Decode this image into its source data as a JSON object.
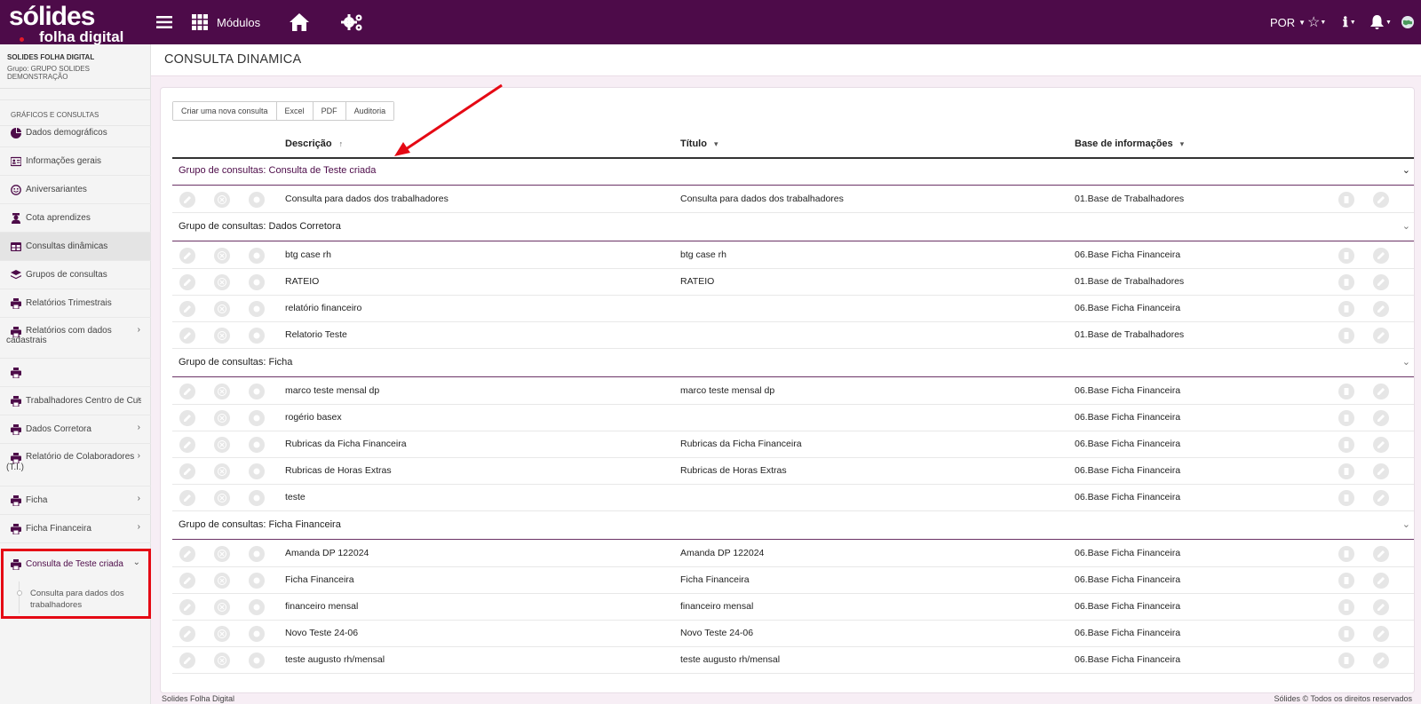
{
  "topbar": {
    "logo_main": "sólides",
    "logo_sub": "folha digital",
    "modules_label": "Módulos",
    "language": "POR"
  },
  "sidebar": {
    "company_name": "SOLIDES FOLHA DIGITAL",
    "company_group": "Grupo: GRUPO SOLIDES DEMONSTRAÇÃO",
    "section_title": "GRÁFICOS E CONSULTAS",
    "items": [
      {
        "label": "Dados demográficos"
      },
      {
        "label": "Informações gerais"
      },
      {
        "label": "Aniversariantes"
      },
      {
        "label": "Cota aprendizes"
      },
      {
        "label": "Consultas dinâmicas"
      },
      {
        "label": "Grupos de consultas"
      },
      {
        "label": "Relatórios Trimestrais"
      },
      {
        "label": "Relatórios com dados",
        "label2": "cadastrais"
      },
      {
        "label": ""
      },
      {
        "label": "Trabalhadores Centro de Custo"
      },
      {
        "label": "Dados Corretora"
      },
      {
        "label": "Relatório de Colaboradores",
        "label2": "(T.I.)"
      },
      {
        "label": "Ficha"
      },
      {
        "label": "Ficha Financeira"
      },
      {
        "label": "Consulta de Teste criada"
      }
    ],
    "submenu_item": "Consulta para dados dos trabalhadores"
  },
  "page": {
    "title": "CONSULTA DINAMICA"
  },
  "toolbar": {
    "new_query": "Criar uma nova consulta",
    "excel": "Excel",
    "pdf": "PDF",
    "audit": "Auditoria"
  },
  "table": {
    "headers": {
      "description": "Descrição",
      "description_sort": "↑",
      "title": "Título",
      "title_sort": "▾",
      "base": "Base de informações",
      "base_sort": "▾"
    },
    "group_prefix": "Grupo de consultas:",
    "groups": [
      {
        "name": "Consulta de Teste criada",
        "rows": [
          {
            "description": "Consulta para dados dos trabalhadores",
            "title": "Consulta para dados dos trabalhadores",
            "base": "01.Base de Trabalhadores"
          }
        ]
      },
      {
        "name": "Dados Corretora",
        "rows": [
          {
            "description": "btg case rh",
            "title": "btg case rh",
            "base": "06.Base Ficha Financeira"
          },
          {
            "description": "RATEIO",
            "title": "RATEIO",
            "base": "01.Base de Trabalhadores"
          },
          {
            "description": "relatório financeiro",
            "title": "",
            "base": "06.Base Ficha Financeira"
          },
          {
            "description": "Relatorio Teste",
            "title": "",
            "base": "01.Base de Trabalhadores"
          }
        ]
      },
      {
        "name": "Ficha",
        "rows": [
          {
            "description": "marco teste mensal dp",
            "title": "marco teste mensal dp",
            "base": "06.Base Ficha Financeira"
          },
          {
            "description": "rogério basex",
            "title": "",
            "base": "06.Base Ficha Financeira"
          },
          {
            "description": "Rubricas da Ficha Financeira",
            "title": "Rubricas da Ficha Financeira",
            "base": "06.Base Ficha Financeira"
          },
          {
            "description": "Rubricas de Horas Extras",
            "title": "Rubricas de Horas Extras",
            "base": "06.Base Ficha Financeira"
          },
          {
            "description": "teste",
            "title": "",
            "base": "06.Base Ficha Financeira"
          }
        ]
      },
      {
        "name": "Ficha Financeira",
        "rows": [
          {
            "description": "Amanda DP 122024",
            "title": "Amanda DP 122024",
            "base": "06.Base Ficha Financeira"
          },
          {
            "description": "Ficha Financeira",
            "title": "Ficha Financeira",
            "base": "06.Base Ficha Financeira"
          },
          {
            "description": "financeiro mensal",
            "title": "financeiro mensal",
            "base": "06.Base Ficha Financeira"
          },
          {
            "description": "Novo Teste 24-06",
            "title": "Novo Teste 24-06",
            "base": "06.Base Ficha Financeira"
          },
          {
            "description": "teste augusto rh/mensal",
            "title": "teste augusto rh/mensal",
            "base": "06.Base Ficha Financeira"
          }
        ]
      }
    ]
  },
  "footer": {
    "left": "Solides Folha Digital",
    "right": "Sólides © Todos os direitos reservados"
  },
  "colors": {
    "brand": "#4d0b49",
    "highlight": "#e50914"
  }
}
